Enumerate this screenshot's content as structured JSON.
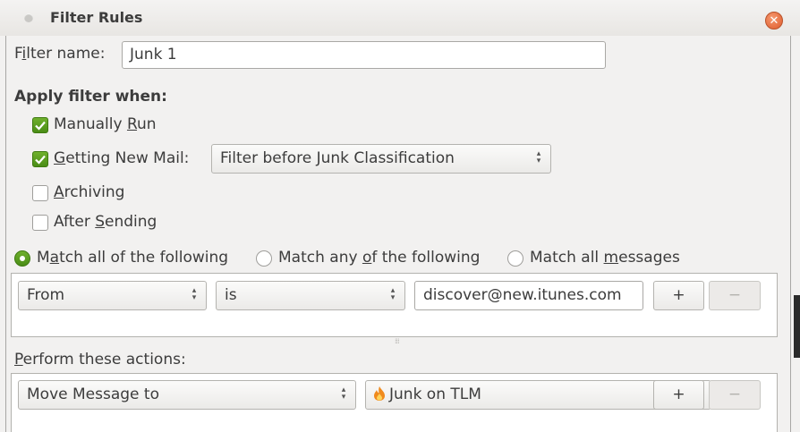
{
  "window": {
    "title": "Filter Rules"
  },
  "filter_name": {
    "label_pre": "F",
    "label_mn": "i",
    "label_post": "lter name:",
    "value": "Junk 1"
  },
  "apply": {
    "heading": "Apply filter when:",
    "manually_run": {
      "pre": "Manually ",
      "mn": "R",
      "post": "un",
      "checked": true
    },
    "getting_new_mail": {
      "pre": "",
      "mn": "G",
      "post": "etting New Mail:",
      "checked": true,
      "option": "Filter before Junk Classification"
    },
    "archiving": {
      "pre": "",
      "mn": "A",
      "post": "rchiving",
      "checked": false
    },
    "after_sending": {
      "pre": "After ",
      "mn": "S",
      "post": "ending",
      "checked": false
    }
  },
  "match": {
    "all": {
      "pre": "M",
      "mn": "a",
      "post": "tch all of the following",
      "selected": true
    },
    "any": {
      "pre": "Match any ",
      "mn": "o",
      "post": "f the following",
      "selected": false
    },
    "messages": {
      "pre": "Match all ",
      "mn": "m",
      "post": "essages",
      "selected": false
    }
  },
  "rule": {
    "field": "From",
    "operator": "is",
    "value": "discover@new.itunes.com",
    "add_label": "+",
    "remove_label": "−"
  },
  "grip": "⁞⁞⁞",
  "actions": {
    "label_pre": "",
    "label_mn": "P",
    "label_post": "erform these actions:",
    "action": "Move Message to",
    "target": "Junk on TLM",
    "add_label": "+",
    "remove_label": "−"
  },
  "colors": {
    "accent": "#5ea224",
    "close": "#e0642f"
  }
}
